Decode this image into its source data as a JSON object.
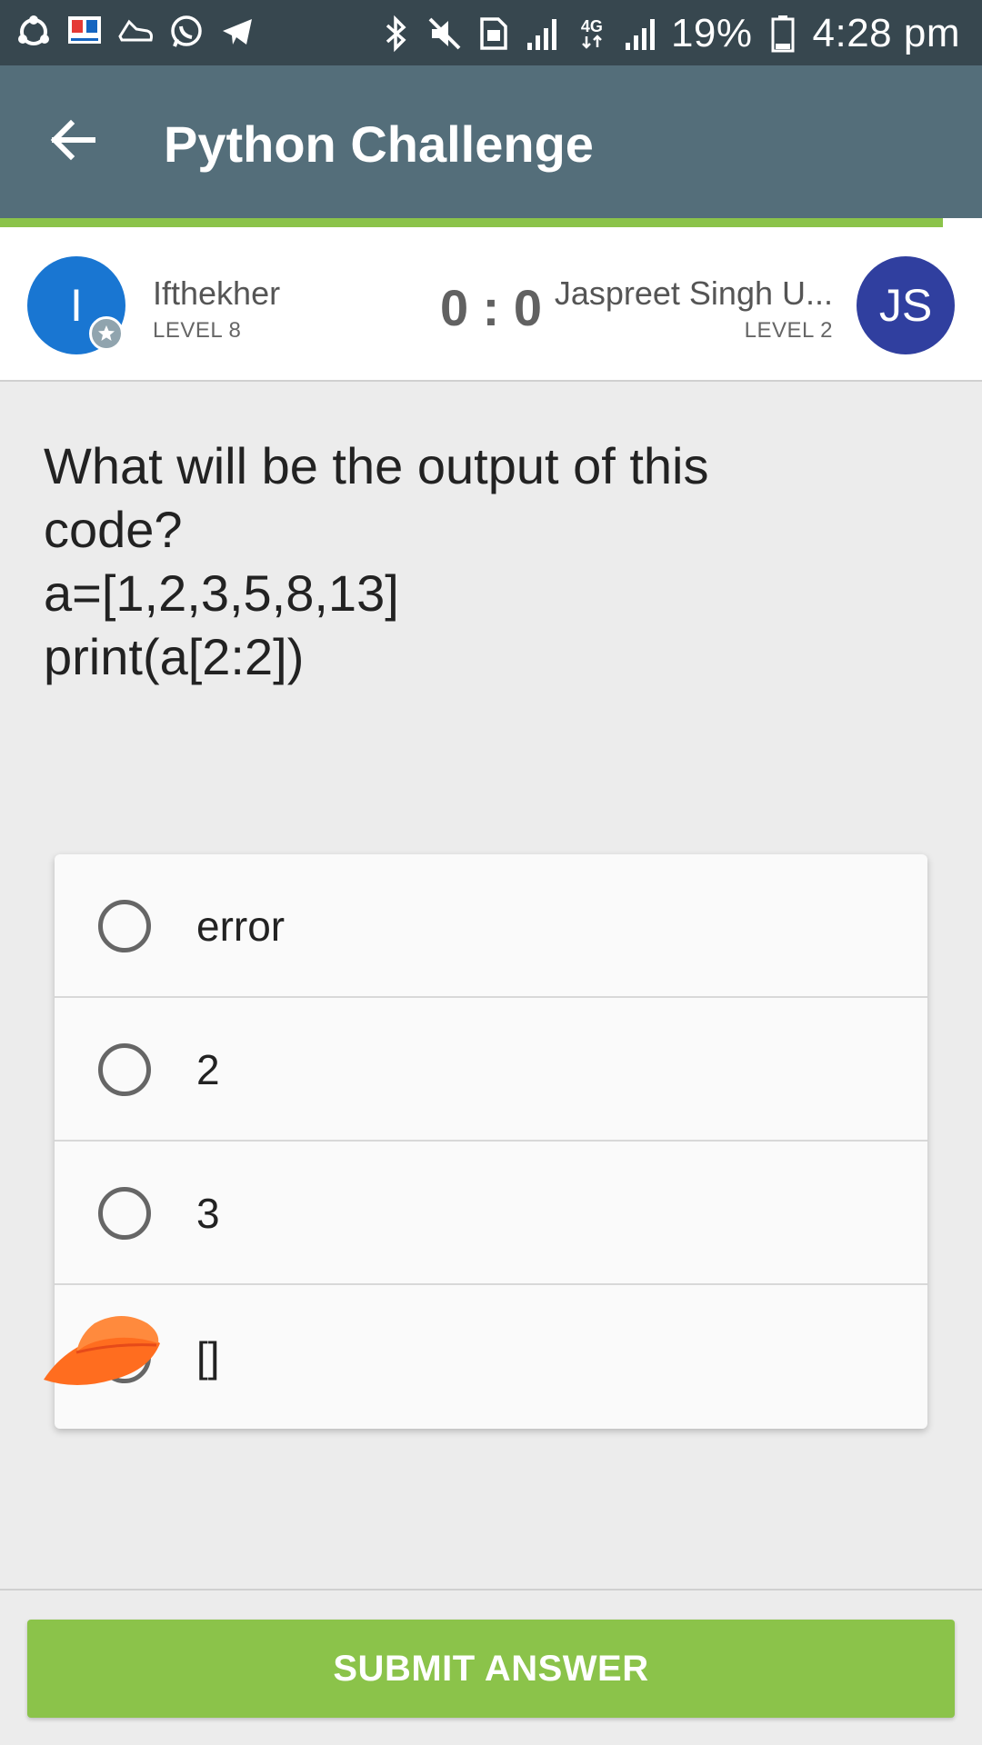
{
  "status_bar": {
    "battery": "19%",
    "time": "4:28 pm",
    "network": "4G",
    "left_icons": [
      "shareit-icon",
      "news-app-icon",
      "sneaker-icon",
      "whatsapp-icon",
      "telegram-icon"
    ],
    "right_icons": [
      "bluetooth-icon",
      "mute-icon",
      "sim-icon",
      "signal-icon",
      "signal-4g-icon",
      "signal-icon",
      "battery-icon"
    ]
  },
  "app_bar": {
    "title": "Python Challenge",
    "back_icon": "arrow-left-icon",
    "color": "#546e7a"
  },
  "progress": {
    "fraction": 0.96,
    "color": "#8bc34a"
  },
  "players": {
    "left": {
      "initial": "I",
      "name": "Ifthekher",
      "level": "LEVEL 8",
      "color": "#1976d2"
    },
    "right": {
      "initial": "JS",
      "name": "Jaspreet Singh U...",
      "level": "LEVEL 2",
      "color": "#303f9f"
    },
    "score": "0 : 0"
  },
  "question": {
    "text": "What will be the output of this\ncode?\na=[1,2,3,5,8,13]\nprint(a[2:2])"
  },
  "options": [
    {
      "label": "error"
    },
    {
      "label": "2"
    },
    {
      "label": "3"
    },
    {
      "label": "[]"
    }
  ],
  "submit": {
    "label": "SUBMIT ANSWER",
    "color": "#8bc34a"
  }
}
